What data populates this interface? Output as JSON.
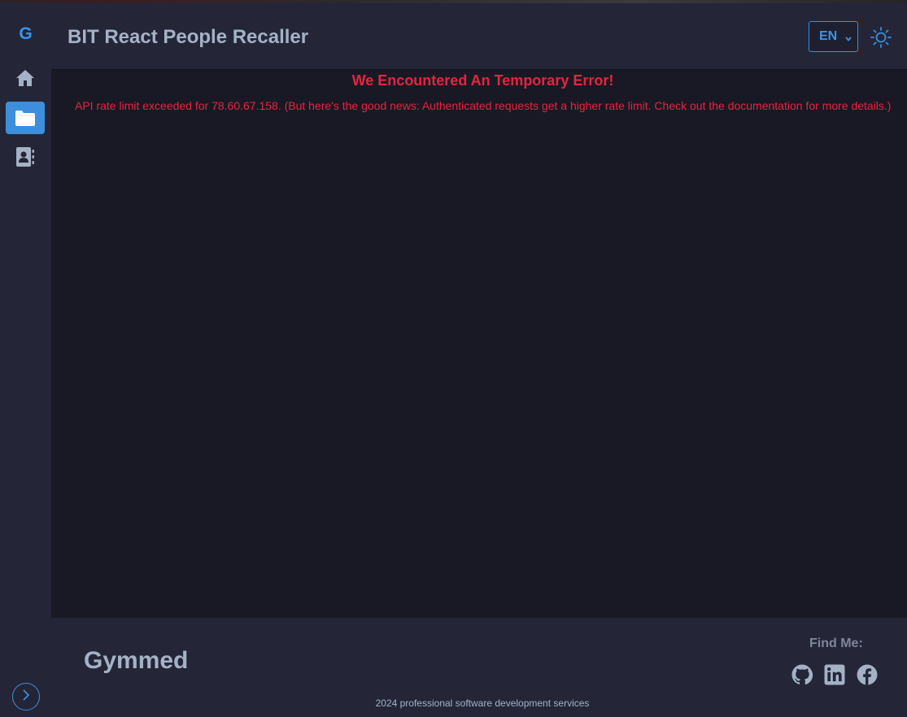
{
  "app": {
    "title": "BIT React People Recaller",
    "logo": "G"
  },
  "sidebar": {
    "items": [
      {
        "name": "home",
        "icon": "home-icon",
        "active": false
      },
      {
        "name": "projects",
        "icon": "folder-icon",
        "active": true
      },
      {
        "name": "contacts",
        "icon": "contact-book-icon",
        "active": false
      }
    ],
    "expand_icon": "chevron-right-icon"
  },
  "header": {
    "language": {
      "selected": "EN"
    },
    "theme_icon": "sun-icon"
  },
  "error": {
    "title": "We Encountered An Temporary Error!",
    "message": "API rate limit exceeded for 78.60.67.158. (But here's the good news: Authenticated requests get a higher rate limit. Check out the documentation for more details.)"
  },
  "footer": {
    "brand": "Gymmed",
    "find_me_label": "Find Me:",
    "social": [
      "github-icon",
      "linkedin-icon",
      "facebook-icon"
    ],
    "copyright": "2024 professional software development services"
  },
  "colors": {
    "accent": "#3d8fdc",
    "error": "#e8233f",
    "panel": "#242638",
    "background": "#181924"
  }
}
